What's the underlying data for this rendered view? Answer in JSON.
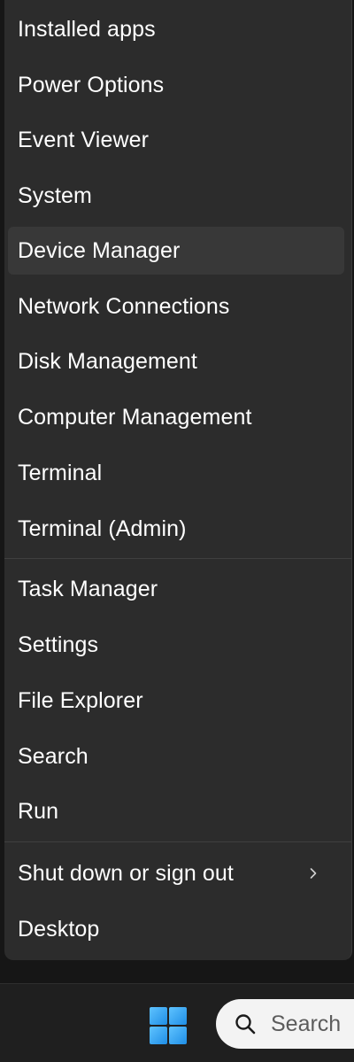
{
  "menu": {
    "items": [
      {
        "label": "Installed apps"
      },
      {
        "label": "Power Options"
      },
      {
        "label": "Event Viewer"
      },
      {
        "label": "System"
      },
      {
        "label": "Device Manager"
      },
      {
        "label": "Network Connections"
      },
      {
        "label": "Disk Management"
      },
      {
        "label": "Computer Management"
      },
      {
        "label": "Terminal"
      },
      {
        "label": "Terminal (Admin)"
      },
      {
        "label": "Task Manager"
      },
      {
        "label": "Settings"
      },
      {
        "label": "File Explorer"
      },
      {
        "label": "Search"
      },
      {
        "label": "Run"
      },
      {
        "label": "Shut down or sign out",
        "icon": "chevron-right-icon"
      },
      {
        "label": "Desktop"
      }
    ],
    "highlighted_item": "Device Manager"
  },
  "taskbar": {
    "start_icon": "windows-logo-icon",
    "search": {
      "icon": "search-icon",
      "text": "Search"
    }
  },
  "colors": {
    "menu_background": "#2c2c2c",
    "hover_background": "#383838",
    "text": "#ffffff",
    "taskbar_background": "#1f1f1f",
    "windows_logo": "#3aa7f0"
  }
}
